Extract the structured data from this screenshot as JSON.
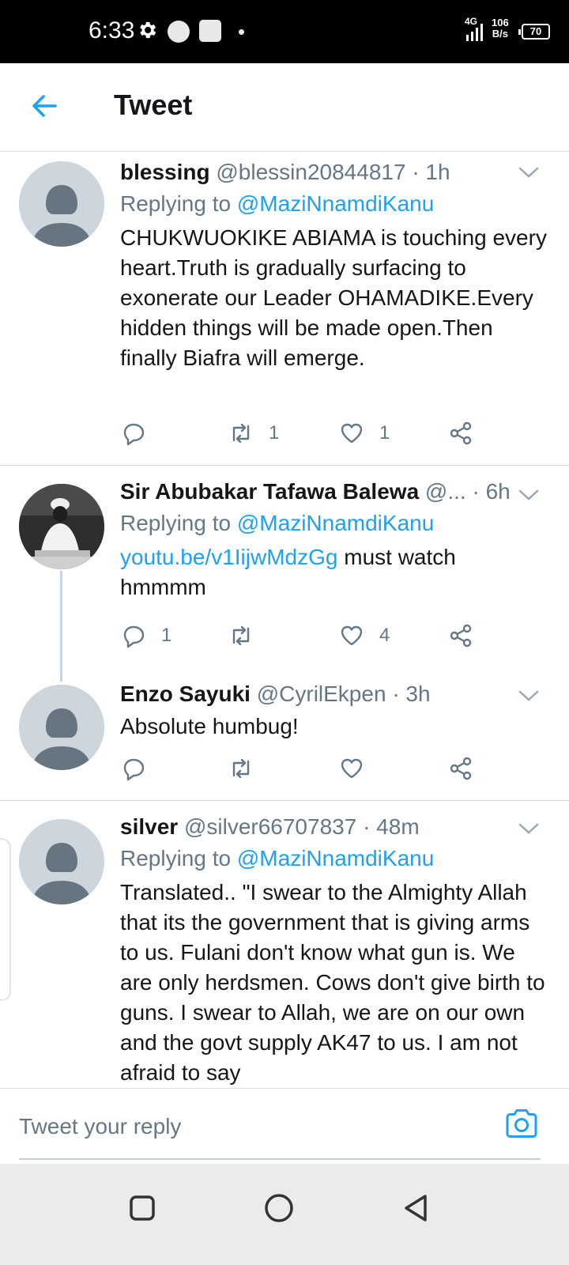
{
  "status_bar": {
    "time": "6:33",
    "network": "4G",
    "speed_value": "106",
    "speed_unit": "B/s",
    "battery": "70"
  },
  "header": {
    "title": "Tweet"
  },
  "tweets": [
    {
      "name": "blessing",
      "handle": "@blessin20844817",
      "time": "· 1h",
      "replying_prefix": "Replying to",
      "replying_to": "@MaziNnamdiKanu",
      "text": "CHUKWUOKIKE ABIAMA is touching every heart.Truth is gradually surfacing to exonerate our Leader OHAMADIKE.Every hidden things will be made open.Then finally Biafra will emerge.",
      "replies": "",
      "retweets": "1",
      "likes": "1"
    },
    {
      "name": "Sir Abubakar Tafawa Balewa",
      "handle": "@...",
      "time": "· 6h",
      "replying_prefix": "Replying to",
      "replying_to": "@MaziNnamdiKanu",
      "link": "youtu.be/v1IijwMdzGg",
      "text": " must watch hmmmm",
      "replies": "1",
      "retweets": "",
      "likes": "4"
    },
    {
      "name": "Enzo Sayuki",
      "handle": "@CyrilEkpen",
      "time": "· 3h",
      "text": "Absolute humbug!",
      "replies": "",
      "retweets": "",
      "likes": ""
    },
    {
      "name": "silver",
      "handle": "@silver66707837",
      "time": "· 48m",
      "replying_prefix": "Replying to",
      "replying_to": "@MaziNnamdiKanu",
      "text": "Translated.. \"I swear to the Almighty Allah that its the government that is giving arms to us. Fulani don't know what gun is. We are only herdsmen. Cows don't give birth to guns. I swear to Allah, we are on our own and the govt supply AK47 to us. I am not afraid to say"
    }
  ],
  "reply_bar": {
    "placeholder": "Tweet your reply"
  },
  "icons": {
    "back": "arrow-left-icon",
    "caret": "chevron-down-icon",
    "reply": "reply-bubble-icon",
    "retweet": "retweet-icon",
    "like": "heart-icon",
    "share": "share-icon",
    "camera": "camera-icon"
  },
  "colors": {
    "accent": "#1da1f2",
    "secondary_text": "#657786",
    "primary_text": "#14171a"
  }
}
